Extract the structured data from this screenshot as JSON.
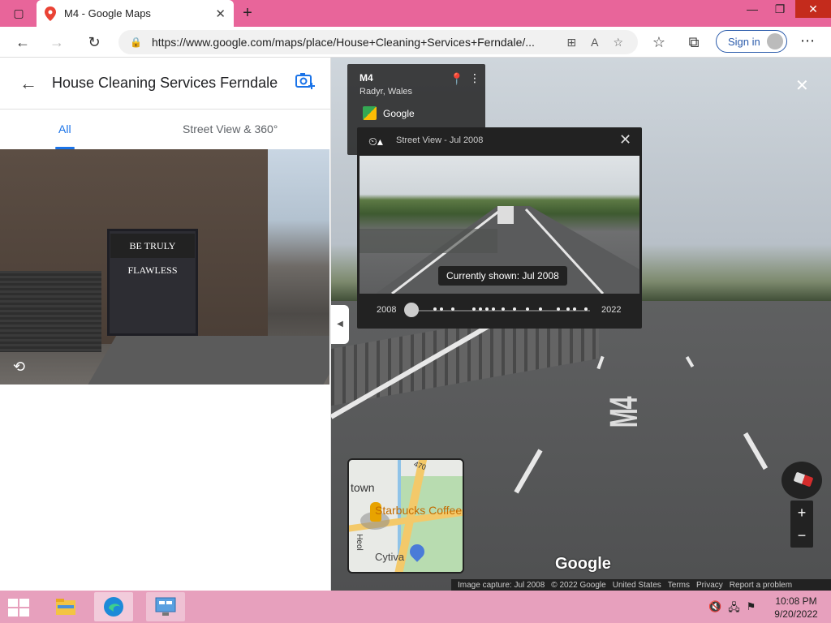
{
  "browser": {
    "tab_title": "M4 - Google Maps",
    "url": "https://www.google.com/maps/place/House+Cleaning+Services+Ferndale/...",
    "sign_in_label": "Sign in"
  },
  "left_panel": {
    "title": "House Cleaning Services Ferndale",
    "tabs": [
      {
        "label": "All",
        "active": true
      },
      {
        "label": "Street View & 360°",
        "active": false
      }
    ],
    "photo_sign_text": "BE TRULY FLAWLESS"
  },
  "info_card": {
    "name": "M4",
    "subtitle": "Radyr, Wales",
    "source": "Google"
  },
  "time_travel": {
    "title": "Street View - Jul 2008",
    "tooltip": "Currently shown: Jul 2008",
    "year_start": "2008",
    "year_end": "2022"
  },
  "street_view": {
    "road_marking": "M4",
    "logo": "Google"
  },
  "minimap": {
    "labels": {
      "town": "town",
      "starbucks": "Starbucks Coffee",
      "cytiva": "Cytiva",
      "heol": "Heol",
      "road_num": "470"
    }
  },
  "zoom": {
    "in": "+",
    "out": "−"
  },
  "footer": {
    "image_capture": "Image capture: Jul 2008",
    "copyright": "© 2022 Google",
    "country": "United States",
    "terms": "Terms",
    "privacy": "Privacy",
    "report": "Report a problem"
  },
  "taskbar": {
    "time": "10:08 PM",
    "date": "9/20/2022"
  },
  "colors": {
    "titlebar": "#e8659a",
    "taskbar": "#e7a0bd",
    "accent": "#1a73e8"
  }
}
